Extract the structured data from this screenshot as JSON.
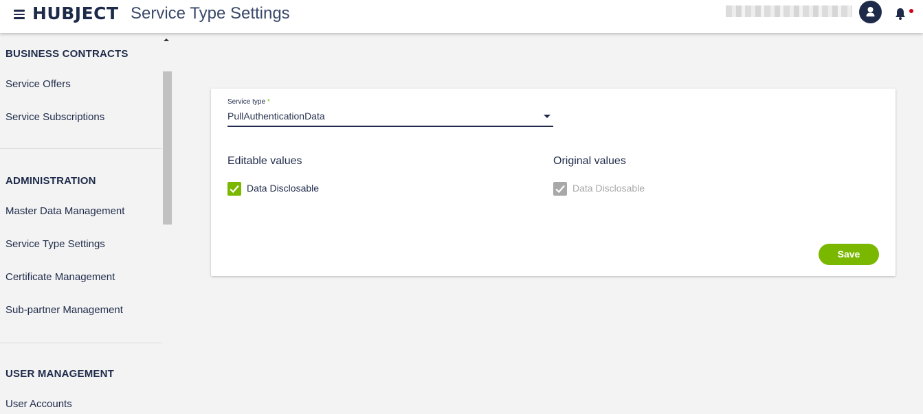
{
  "header": {
    "logo": "HUBJECT",
    "page_title": "Service Type Settings"
  },
  "sidebar": {
    "sections": [
      {
        "title": "BUSINESS CONTRACTS",
        "items": [
          "Service Offers",
          "Service Subscriptions"
        ]
      },
      {
        "title": "ADMINISTRATION",
        "items": [
          "Master Data Management",
          "Service Type Settings",
          "Certificate Management",
          "Sub-partner Management"
        ]
      },
      {
        "title": "USER MANAGEMENT",
        "items": [
          "User Accounts"
        ]
      }
    ]
  },
  "form": {
    "service_type_label": "Service type",
    "required_mark": "*",
    "service_type_value": "PullAuthenticationData",
    "editable_title": "Editable values",
    "original_title": "Original values",
    "editable_checkbox_label": "Data Disclosable",
    "editable_checkbox_checked": true,
    "original_checkbox_label": "Data Disclosable",
    "original_checkbox_checked": true,
    "save_label": "Save"
  },
  "icons": {
    "menu": "hamburger-menu-icon",
    "avatar": "user-avatar-icon",
    "bell": "notification-bell-icon",
    "dropdown": "dropdown-arrow-icon",
    "check": "check-icon"
  },
  "colors": {
    "brand_navy": "#1e2a4a",
    "accent_green": "#7ab800",
    "disabled_gray": "#a8a8a8",
    "notification_red": "#d0021b"
  }
}
